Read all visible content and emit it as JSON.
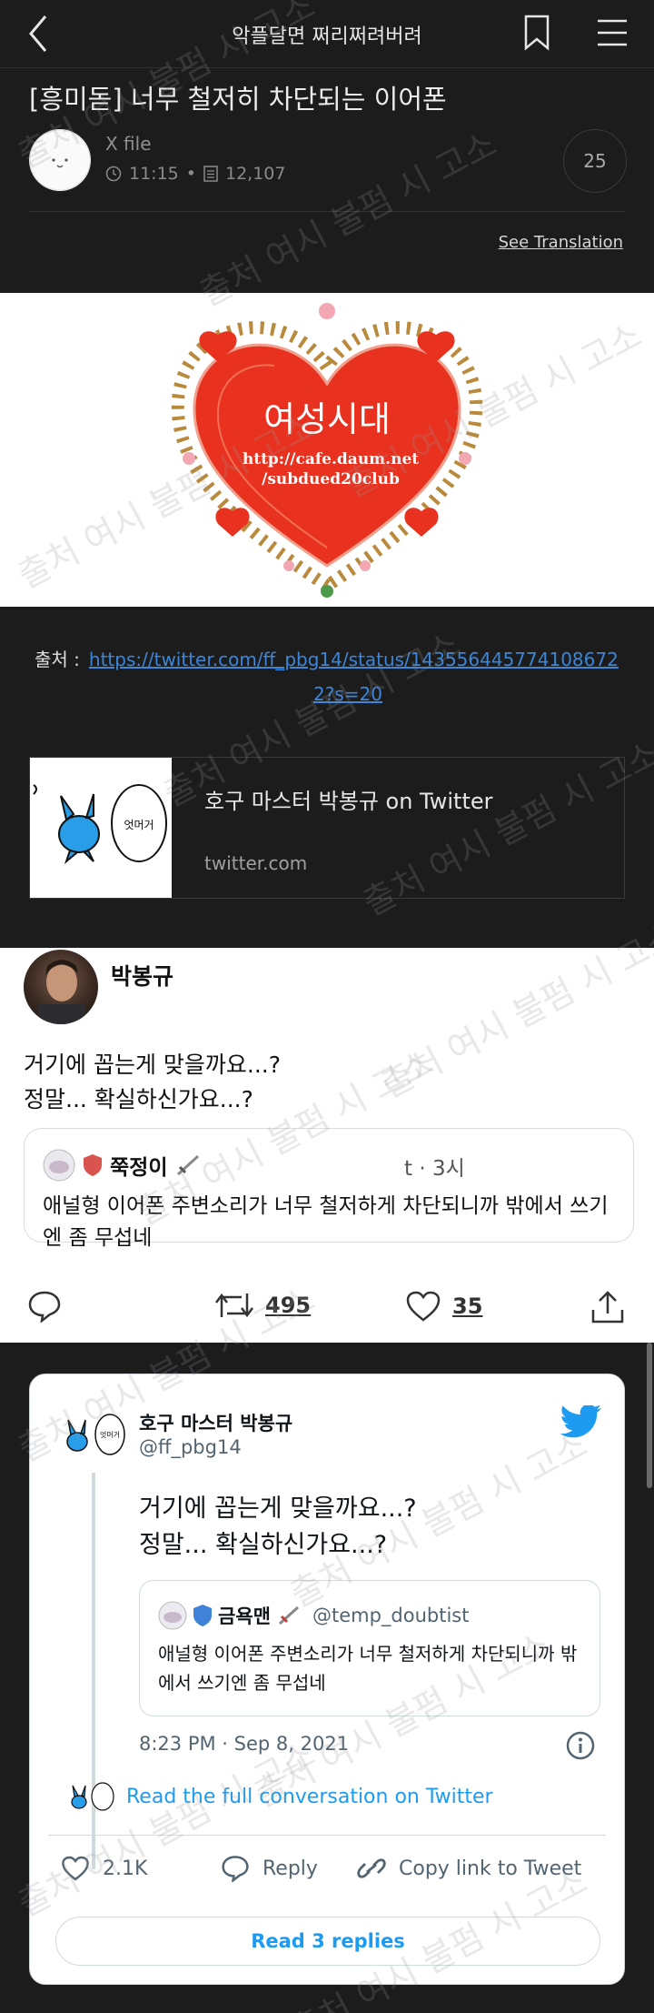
{
  "header": {
    "title": "악플달면 쩌리쩌려버려"
  },
  "post": {
    "title": "[흥미돋] 너무 철저히 차단되는 이어폰",
    "author": "X file",
    "time": "11:15",
    "separator": "•",
    "views": "12,107",
    "comment_count": "25",
    "see_translation": "See Translation"
  },
  "banner": {
    "main_text": "여성시대",
    "url_line1": "http://cafe.daum.net",
    "url_line2": "/subdued20club"
  },
  "source": {
    "label": "출처 :",
    "url_part1": "https://twitter.com/ff_pbg14/status/143556445774108672",
    "url_part2": "2?s=20"
  },
  "link_card": {
    "thumb_text": "엇머거",
    "title": "호구 마스터 박봉규 on Twitter",
    "domain": "twitter.com"
  },
  "tweet_screenshot": {
    "name": "박봉규",
    "body_line1": "거기에 꼽는게 맞을까요...?",
    "body_line2": "정말... 확실하신가요...?",
    "quote_name": "쭉정이",
    "quote_time": "t · 3시",
    "quote_text": "애널형 이어폰 주변소리가 너무 철저하게 차단되니까 밖에서 쓰기엔 좀 무섭네",
    "retweets": "495",
    "likes": "35"
  },
  "embed": {
    "name": "호구 마스터 박봉규",
    "handle": "@ff_pbg14",
    "avatar_text": "엇머거",
    "body_line1": "거기에 꼽는게 맞을까요...?",
    "body_line2": "정말... 확실하신가요...?",
    "quote_name": "금욕맨",
    "quote_handle": "@temp_doubtist",
    "quote_text": "애널형 이어폰 주변소리가 너무 철저하게 차단되니까 밖에서 쓰기엔 좀 무섭네",
    "date": "8:23 PM · Sep 8, 2021",
    "read_conversation": "Read the full conversation on Twitter",
    "likes": "2.1K",
    "reply": "Reply",
    "copy_link": "Copy link to Tweet",
    "read_replies": "Read 3 replies"
  },
  "watermark": "출처 여시 불펌 시 고소",
  "colors": {
    "background": "#1c1c1c",
    "link": "#3b86d9",
    "twitter_blue": "#1d9bf0",
    "heart_red": "#e8321f"
  }
}
